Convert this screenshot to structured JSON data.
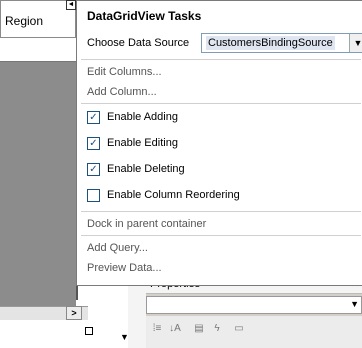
{
  "grid": {
    "column_header": "Region",
    "scroll_right": ">",
    "smart_tag_glyph": "◄"
  },
  "panel": {
    "title": "DataGridView Tasks",
    "choose_source_label": "Choose Data Source",
    "data_source_value": "CustomersBindingSource",
    "data_source_arrow": "▼",
    "edit_columns": "Edit Columns...",
    "add_column": "Add Column...",
    "checkboxes": [
      {
        "label": "Enable Adding",
        "checked": true,
        "mark": "✓"
      },
      {
        "label": "Enable Editing",
        "checked": true,
        "mark": "✓"
      },
      {
        "label": "Enable Deleting",
        "checked": true,
        "mark": "✓"
      },
      {
        "label": "Enable Column Reordering",
        "checked": false,
        "mark": ""
      }
    ],
    "dock": "Dock in parent container",
    "add_query": "Add Query...",
    "preview_data": "Preview Data..."
  },
  "properties": {
    "title": "Properties",
    "pin": "▾ ╨",
    "close": "✕",
    "combo_arrow": "▼",
    "toolbar_icons": [
      {
        "name": "categorized-icon",
        "glyph": "⁞≡"
      },
      {
        "name": "alphabetical-icon",
        "glyph": "↓A"
      },
      {
        "name": "properties-icon",
        "glyph": "▤"
      },
      {
        "name": "events-icon",
        "glyph": "ϟ"
      },
      {
        "name": "property-pages-icon",
        "glyph": "▭"
      }
    ],
    "side_arrow": "▼"
  },
  "colors": {
    "accent": "#1c5180",
    "grid_body": "#8c8c8c",
    "link_text": "#555555"
  }
}
